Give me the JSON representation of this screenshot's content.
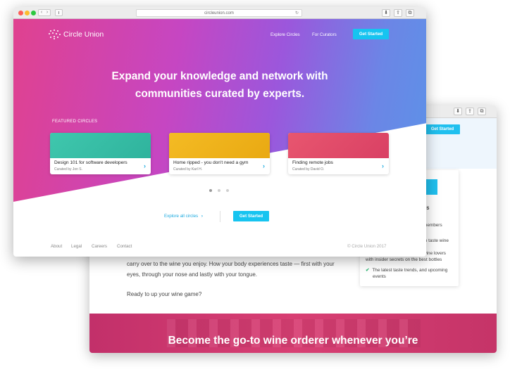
{
  "back_window": {
    "top_button": "Get Started",
    "card": {
      "title_partial": "ES",
      "items": [
        {
          "line1": "members",
          "line2": ""
        },
        {
          "line1": "to taste wine",
          "line2": ""
        },
        {
          "line1": "wine lovers",
          "line2": "with insider secrets on the best bottles"
        },
        {
          "line1": "The latest taste trends, and upcoming",
          "line2": "events"
        }
      ]
    },
    "body_lines": [
      "carry over to the wine you enjoy. How your body experiences taste — first with your",
      "eyes, through your nose and lastly with your tongue.",
      "Ready to up your wine game?"
    ],
    "hero_text": "Become the go-to wine orderer whenever you’re"
  },
  "front_window": {
    "url": "circleunion.com",
    "brand": "Circle Union",
    "nav": {
      "explore": "Explore Circles",
      "curators": "For Curators",
      "cta": "Get Started"
    },
    "headline": {
      "line1": "Expand your knowledge and network with",
      "line2": "communities curated by experts."
    },
    "featured_label": "FEATURED CIRCLES",
    "cards": [
      {
        "title": "Design 101 for software developers",
        "curator": "Curated by Jon S.",
        "color": "#38c2a6"
      },
      {
        "title": "Home ripped - you don't need a gym",
        "curator": "Curated by Karl H.",
        "color": "#f0b21a"
      },
      {
        "title": "Finding remote jobs",
        "curator": "Curated by David O.",
        "color": "#e04a6c"
      }
    ],
    "carousel": {
      "pages": 3,
      "active": 1
    },
    "explore_link": "Explore all circles",
    "explore_arrow": "›",
    "cta_secondary": "Get Started",
    "footer": {
      "links": [
        "About",
        "Legal",
        "Careers",
        "Contact"
      ],
      "copyright": "© Circle Union 2017"
    }
  },
  "colors": {
    "accent": "#17c4f0",
    "link": "#1aa9df",
    "hero_start": "#e0418f",
    "hero_mid": "#9b57dc",
    "hero_end": "#5c92e8"
  }
}
